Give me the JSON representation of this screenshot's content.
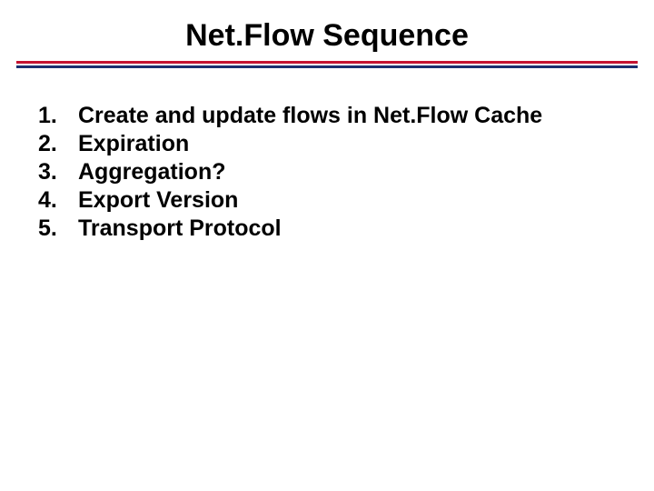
{
  "title": "Net.Flow Sequence",
  "items": [
    {
      "num": "1.",
      "text": "Create and update flows in Net.Flow Cache"
    },
    {
      "num": "2.",
      "text": "Expiration"
    },
    {
      "num": "3.",
      "text": "Aggregation?"
    },
    {
      "num": "4.",
      "text": "Export Version"
    },
    {
      "num": "5.",
      "text": "Transport Protocol"
    }
  ]
}
